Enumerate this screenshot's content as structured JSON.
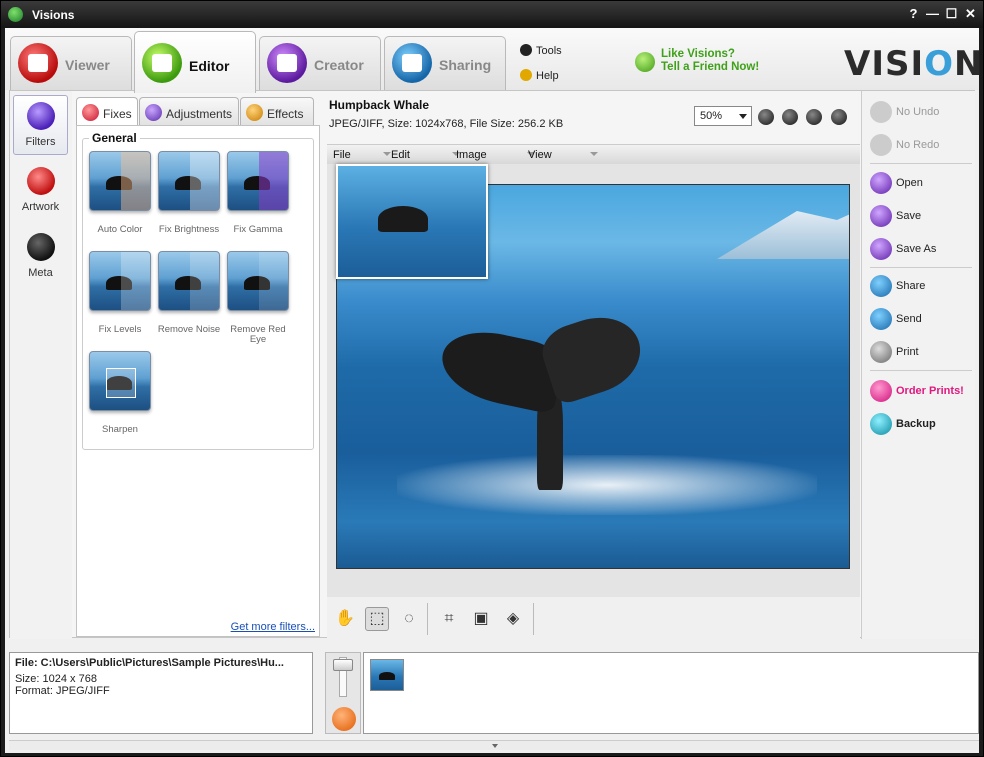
{
  "window": {
    "title": "Visions",
    "help": "?",
    "minimize": "—",
    "maximize": "☐",
    "close": "✕"
  },
  "tabs": [
    {
      "label": "Viewer"
    },
    {
      "label": "Editor"
    },
    {
      "label": "Creator"
    },
    {
      "label": "Sharing"
    }
  ],
  "header": {
    "tools": "Tools",
    "help": "Help",
    "promo_line1": "Like Visions?",
    "promo_line2": "Tell a Friend Now!",
    "logo_pre": "VISI",
    "logo_o": "O",
    "logo_post": "NS"
  },
  "leftnav": [
    {
      "label": "Filters"
    },
    {
      "label": "Artwork"
    },
    {
      "label": "Meta"
    }
  ],
  "subtabs": [
    {
      "label": "Fixes"
    },
    {
      "label": "Adjustments"
    },
    {
      "label": "Effects"
    }
  ],
  "filters": {
    "group_title": "General",
    "items": [
      {
        "label": "Auto Color"
      },
      {
        "label": "Fix Brightness"
      },
      {
        "label": "Fix Gamma"
      },
      {
        "label": "Fix Levels"
      },
      {
        "label": "Remove Noise"
      },
      {
        "label": "Remove Red Eye"
      },
      {
        "label": "Sharpen"
      }
    ],
    "more_link": "Get more filters..."
  },
  "image": {
    "title": "Humpback Whale",
    "info": "JPEG/JIFF, Size: 1024x768, File Size: 256.2 KB",
    "zoom": "50%"
  },
  "menu": [
    {
      "label": "File"
    },
    {
      "label": "Edit"
    },
    {
      "label": "Image"
    },
    {
      "label": "View"
    }
  ],
  "actions": {
    "undo": "No Undo",
    "redo": "No Redo",
    "open": "Open",
    "save": "Save",
    "save_as": "Save As",
    "share": "Share",
    "send": "Send",
    "print": "Print",
    "order": "Order Prints!",
    "backup": "Backup"
  },
  "fileinfo": {
    "path": "File: C:\\Users\\Public\\Pictures\\Sample Pictures\\Hu...",
    "size": "Size: 1024 x 768",
    "format": "Format: JPEG/JIFF"
  },
  "colors": {
    "accent": "#3fa11a",
    "order": "#e0187e",
    "link": "#1a4fb5"
  }
}
